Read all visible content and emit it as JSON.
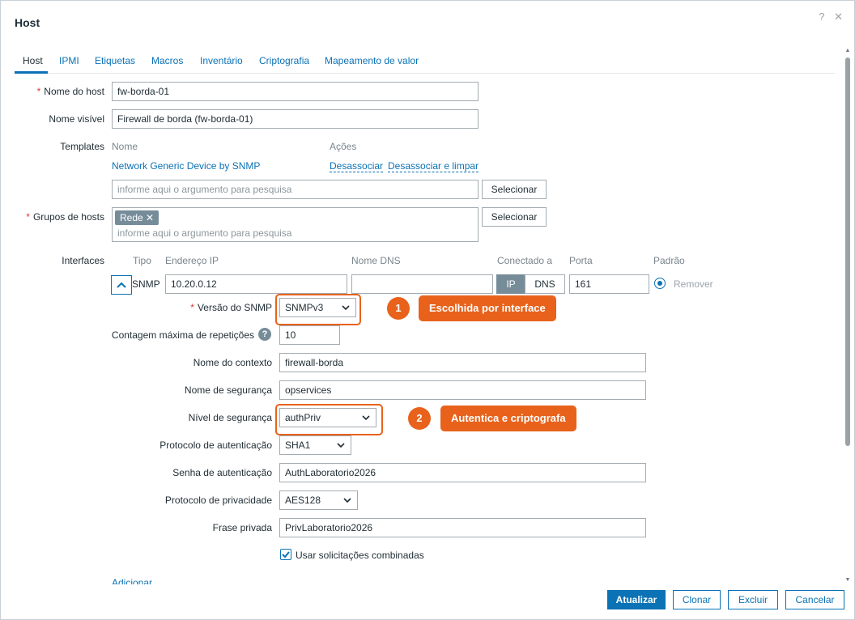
{
  "dialog": {
    "title": "Host",
    "help_icon": "?",
    "close_icon": "✕"
  },
  "tabs": [
    "Host",
    "IPMI",
    "Etiquetas",
    "Macros",
    "Inventário",
    "Criptografia",
    "Mapeamento de valor"
  ],
  "form": {
    "host_name": {
      "label": "Nome do host",
      "value": "fw-borda-01"
    },
    "visible_name": {
      "label": "Nome visível",
      "value": "Firewall de borda (fw-borda-01)"
    },
    "templates": {
      "label": "Templates",
      "col_name": "Nome",
      "col_actions": "Ações",
      "item_name": "Network Generic Device by SNMP",
      "unlink": "Desassociar",
      "unlink_clear": "Desassociar e limpar",
      "search_placeholder": "informe aqui o argumento para pesquisa",
      "select_button": "Selecionar"
    },
    "host_groups": {
      "label": "Grupos de hosts",
      "tag": "Rede",
      "tag_remove": "✕",
      "search_placeholder": "informe aqui o argumento para pesquisa",
      "select_button": "Selecionar"
    },
    "interfaces": {
      "label": "Interfaces",
      "headers": {
        "type": "Tipo",
        "ip": "Endereço IP",
        "dns": "Nome DNS",
        "connect": "Conectado a",
        "port": "Porta",
        "default": "Padrão"
      },
      "row": {
        "type": "SNMP",
        "ip": "10.20.0.12",
        "dns": "",
        "ip_btn": "IP",
        "dns_btn": "DNS",
        "port": "161",
        "remove": "Remover"
      }
    },
    "snmp": {
      "version": {
        "label": "Versão do SNMP",
        "value": "SNMPv3"
      },
      "max_repetitions": {
        "label": "Contagem máxima de repetições",
        "value": "10",
        "help": "?"
      },
      "context_name": {
        "label": "Nome do contexto",
        "value": "firewall-borda"
      },
      "security_name": {
        "label": "Nome de segurança",
        "value": "opservices"
      },
      "security_level": {
        "label": "Nível de segurança",
        "value": "authPriv"
      },
      "auth_protocol": {
        "label": "Protocolo de autenticação",
        "value": "SHA1"
      },
      "auth_password": {
        "label": "Senha de autenticação",
        "value": "AuthLaboratorio2026"
      },
      "priv_protocol": {
        "label": "Protocolo de privacidade",
        "value": "AES128"
      },
      "priv_passphrase": {
        "label": "Frase privada",
        "value": "PrivLaboratorio2026"
      },
      "bulk": {
        "label": "Usar solicitações combinadas",
        "checked": true
      }
    },
    "add_link": "Adicionar"
  },
  "annotations": [
    {
      "number": "1",
      "text": "Escolhida por interface"
    },
    {
      "number": "2",
      "text": "Autentica e criptografa"
    }
  ],
  "footer": {
    "update": "Atualizar",
    "clone": "Clonar",
    "delete": "Excluir",
    "cancel": "Cancelar"
  },
  "colors": {
    "accent": "#0b72b5",
    "annotation": "#e8621c",
    "required": "#e33734",
    "tag": "#768d99"
  }
}
